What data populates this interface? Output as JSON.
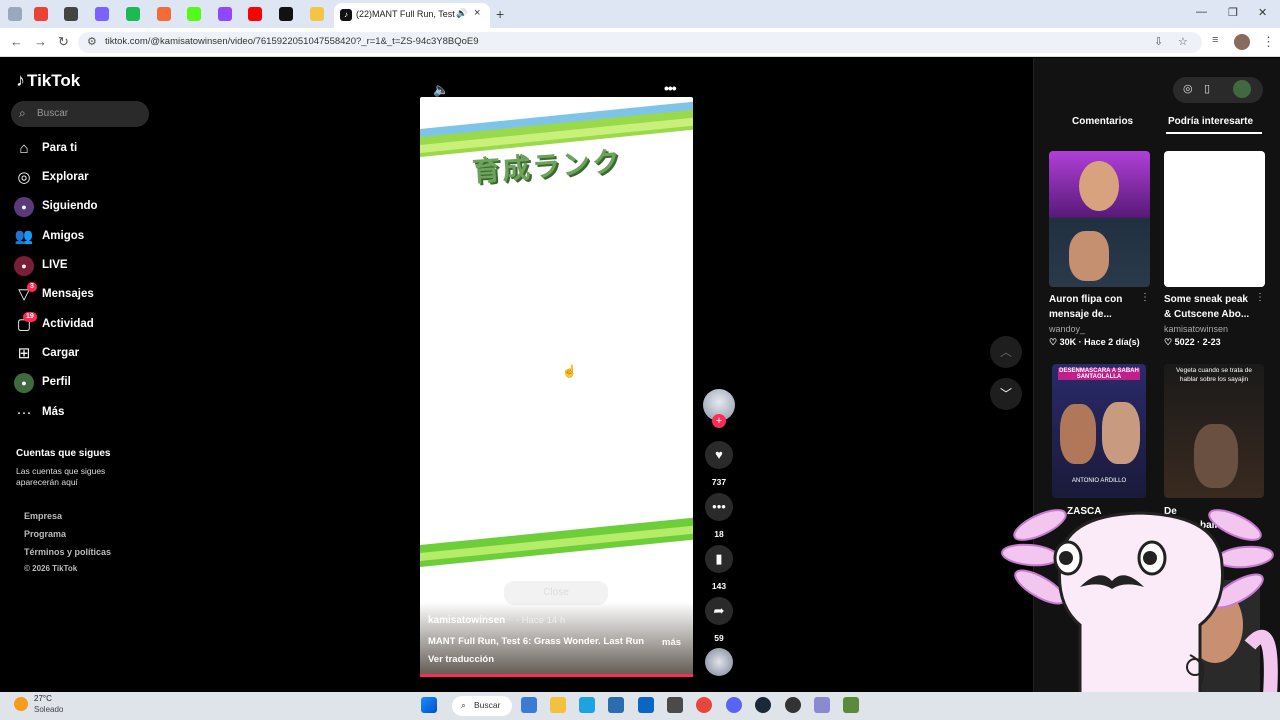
{
  "browser": {
    "active_tab_title": "(22)MANT Full Run, Test 6: ...",
    "url": "tiktok.com/@kamisatowinsen/video/7615922051047558420?_r=1&_t=ZS-94c3Y8BQoE9"
  },
  "sidebar": {
    "logo": "TikTok",
    "search_placeholder": "Buscar",
    "items": [
      {
        "label": "Para ti",
        "icon": "home-icon"
      },
      {
        "label": "Explorar",
        "icon": "compass-icon"
      },
      {
        "label": "Siguiendo",
        "icon": "following-avatar-icon"
      },
      {
        "label": "Amigos",
        "icon": "friends-icon"
      },
      {
        "label": "LIVE",
        "icon": "live-icon"
      },
      {
        "label": "Mensajes",
        "icon": "messages-icon",
        "badge": "3"
      },
      {
        "label": "Actividad",
        "icon": "activity-icon",
        "badge": "19"
      },
      {
        "label": "Cargar",
        "icon": "upload-icon"
      },
      {
        "label": "Perfil",
        "icon": "profile-avatar-icon"
      },
      {
        "label": "Más",
        "icon": "more-icon"
      }
    ],
    "following_heading": "Cuentas que sigues",
    "following_text": "Las cuentas que sigues aparecerán aquí",
    "footer": [
      "Empresa",
      "Programa",
      "Términos y políticas"
    ],
    "copyright": "© 2026 TikTok"
  },
  "video": {
    "title_jp": "育成ランク",
    "close_label": "Close",
    "author": "kamisatowinsen",
    "posted": "· Hace 14 h",
    "caption": "MANT Full Run, Test 6: Grass Wonder. Last Run",
    "more": "más",
    "translate": "Ver traducción"
  },
  "actions": {
    "likes": "737",
    "comments": "18",
    "saves": "143",
    "shares": "59"
  },
  "right_panel": {
    "tabs": [
      "Comentarios",
      "Podría interesarte"
    ],
    "active_tab": "Podría interesarte",
    "cards": [
      {
        "title": "Auron flipa con mensaje de...",
        "user": "wandoy_",
        "likes": "30K",
        "date": "Hace 2 día(s)"
      },
      {
        "title": "Some sneak peak & Cutscene Abo...",
        "user": "kamisatowinsen",
        "likes": "5022",
        "date": "2-23"
      },
      {
        "title": "ZASCA",
        "thumb_text": "DESENMASCARA A SABAH SANTAOLALLA",
        "thumb_caption": "ANTONIO ARDILLO"
      },
      {
        "title": "De",
        "thumb_text": "Vegeta cuando se trata de hablar sobre los sayajin",
        "subtitle": "ball"
      }
    ]
  },
  "taskbar": {
    "temp": "27°C",
    "weather": "Soleado",
    "search_label": "Buscar"
  },
  "colors": {
    "accent": "#fe2c55",
    "background": "#000000",
    "panel": "#121212"
  }
}
